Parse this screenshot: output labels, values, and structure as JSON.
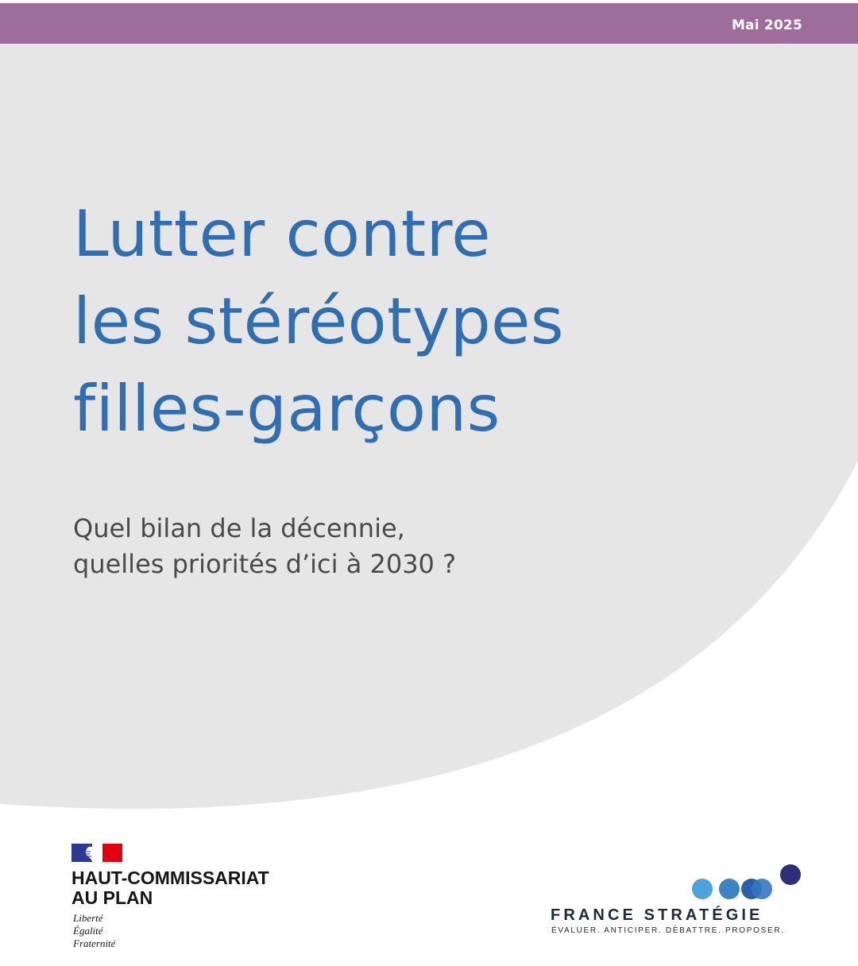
{
  "header": {
    "date": "Mai 2025"
  },
  "title": {
    "lines": [
      "Lutter contre",
      "les stéréotypes",
      "filles-garçons"
    ]
  },
  "subtitle": {
    "lines": [
      "Quel bilan de la décennie,",
      "quelles priorités d’ici à 2030 ?"
    ]
  },
  "logos": {
    "left": {
      "name_lines": [
        "HAUT-COMMISSARIAT",
        "AU PLAN"
      ],
      "motto": [
        "Liberté",
        "Égalité",
        "Fraternité"
      ]
    },
    "right": {
      "name": "FRANCE STRATÉGIE",
      "tagline": "ÉVALUER. ANTICIPER. DÉBATTRE. PROPOSER."
    }
  },
  "colors": {
    "band": "#9d6d9b",
    "background_shape": "#e6e6e7",
    "title": "#2f6eb0",
    "subtitle": "#4a4a4a",
    "flag_blue": "#2b3990",
    "flag_red": "#e1000f",
    "dot_light": "#4aa3dd",
    "dot_mid": "#3a85c2",
    "dot_dark": "#2b5fa7",
    "dot_navy": "#2e2f7a"
  }
}
